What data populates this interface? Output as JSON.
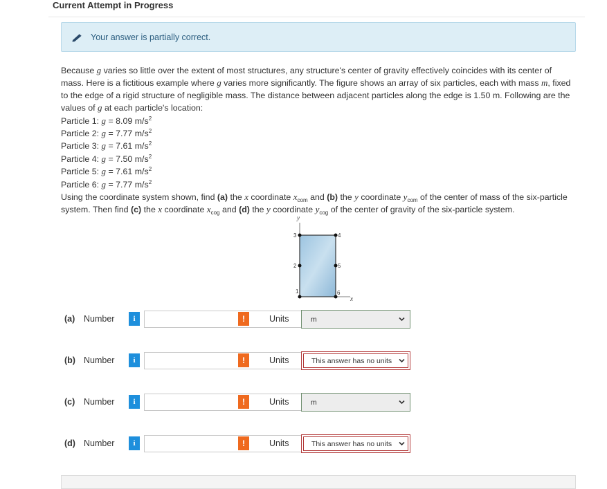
{
  "header": {
    "title": "Current Attempt in Progress"
  },
  "feedback": {
    "icon": "pencil-icon",
    "message": "Your answer is partially correct."
  },
  "problem": {
    "intro_1": "Because ",
    "g": "g",
    "intro_2": " varies so little over the extent of most structures, any structure's center of gravity effectively coincides with its center of mass. Here is a fictitious example where ",
    "intro_3": " varies more significantly. The figure shows an array of six particles, each with mass ",
    "m": "m",
    "intro_4": ", fixed to the edge of a rigid structure of negligible mass. The distance between adjacent particles along the edge is 1.50 m. Following are the values of ",
    "intro_5": " at each particle's location:",
    "particles": [
      {
        "label": "Particle 1: ",
        "value": " = 8.09 m/s",
        "exp": "2"
      },
      {
        "label": "Particle 2: ",
        "value": " = 7.77 m/s",
        "exp": "2"
      },
      {
        "label": "Particle 3: ",
        "value": " = 7.61 m/s",
        "exp": "2"
      },
      {
        "label": "Particle 4: ",
        "value": " = 7.50 m/s",
        "exp": "2"
      },
      {
        "label": "Particle 5: ",
        "value": " = 7.61 m/s",
        "exp": "2"
      },
      {
        "label": "Particle 6: ",
        "value": " = 7.77 m/s",
        "exp": "2"
      }
    ],
    "q1": "Using the coordinate system shown, find ",
    "qa": "(a)",
    "q2": " the ",
    "x": "x",
    "q3": " coordinate ",
    "xcom_var": "x",
    "com_sub": "com",
    "q4": " and ",
    "qb": "(b)",
    "q5": " the ",
    "y": "y",
    "q6": " coordinate ",
    "ycom_var": "y",
    "q7": " of the center of mass of the six-particle system. Then find ",
    "qc": "(c)",
    "q8": " the ",
    "q9": " coordinate ",
    "cog_sub": "cog",
    "q10": " and ",
    "qd": "(d)",
    "q11": " the ",
    "q12": " coordinate ",
    "q13": " of the center of gravity of the six-particle system."
  },
  "figure": {
    "axis_x": "x",
    "axis_y": "y",
    "points": [
      "1",
      "2",
      "3",
      "4",
      "5",
      "6"
    ]
  },
  "answers": [
    {
      "part": "(a)",
      "number_label": "Number",
      "value": "",
      "units_label": "Units",
      "units": "m",
      "status": "ok"
    },
    {
      "part": "(b)",
      "number_label": "Number",
      "value": "",
      "units_label": "Units",
      "units": "This answer has no units",
      "status": "bad"
    },
    {
      "part": "(c)",
      "number_label": "Number",
      "value": "",
      "units_label": "Units",
      "units": "m",
      "status": "ok"
    },
    {
      "part": "(d)",
      "number_label": "Number",
      "value": "",
      "units_label": "Units",
      "units": "This answer has no units",
      "status": "bad"
    }
  ],
  "icons": {
    "info": "i",
    "warning": "!"
  },
  "colors": {
    "info": "#1e8fdc",
    "warning": "#ef6a1f",
    "feedback_bg": "#ddeef6",
    "error_border": "#b33a3a"
  }
}
